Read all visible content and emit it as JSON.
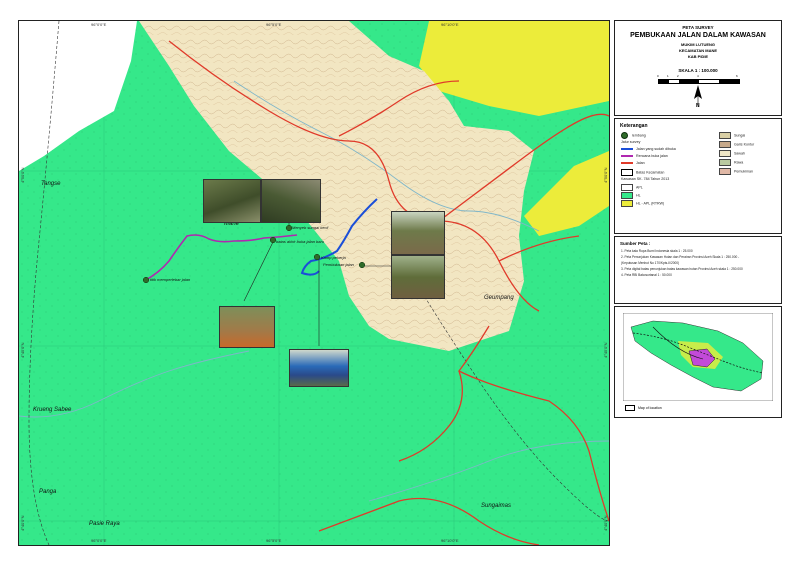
{
  "coords": {
    "top": [
      "96°0'0\"E",
      "96°5'0\"E",
      "96°10'0\"E"
    ],
    "bottom": [
      "96°0'0\"E",
      "96°5'0\"E",
      "96°10'0\"E"
    ],
    "left": [
      "4°50'0\"N",
      "4°45'0\"N",
      "4°40'0\"N"
    ],
    "right": [
      "4°50'0\"N",
      "4°45'0\"N",
      "4°40'0\"N"
    ]
  },
  "places": {
    "tangse": "Tangse",
    "mane": "Mane",
    "geumpang": "Geumpang",
    "krueng_sabee": "Krueng Sabee",
    "panga": "Panga",
    "pasie_raya": "Pasie Raya",
    "sungaimas": "Sungaimas"
  },
  "annotations": {
    "menyeb": "Menyeb sungai kecil",
    "batas": "batas akhir buka jalan baru",
    "pembukaan": "Pembukaan jalan",
    "kamp": "Kamp pekerja",
    "titik": "titik memperlebar jalan"
  },
  "title": {
    "survey": "PETA SURVEY",
    "main": "PEMBUKAAN JALAN DALAM KAWASAN",
    "mukim": "MUKIM LUTUENG",
    "kecamatan": "KECAMATAN MANE",
    "kab": "KAB PIDIE",
    "scale": "SKALA 1 : 100.000",
    "scale_nums": [
      "0",
      "1",
      "2",
      "4",
      "6"
    ],
    "north": "N"
  },
  "legend": {
    "heading": "Keterangan",
    "left": [
      {
        "label": "lembang",
        "kind": "dot"
      },
      {
        "label": "Jalur survey",
        "kind": "head"
      },
      {
        "label": "Jalan yang sudah dibuka",
        "kind": "line",
        "color": "#1b4fd8"
      },
      {
        "label": "Rencana buka jalan",
        "kind": "line",
        "color": "#b028b0"
      },
      {
        "label": "Jalan",
        "kind": "line",
        "color": "#e03a2a"
      },
      {
        "label": "Batas Kecamatan",
        "kind": "box"
      },
      {
        "label": "Kawasan SK. 784 Tahun 2013",
        "kind": "head"
      },
      {
        "label": "APL",
        "kind": "fill",
        "color": "#ffffff"
      },
      {
        "label": "HL",
        "kind": "fill",
        "color": "#35e88a"
      },
      {
        "label": "HL - APL (RTRW)",
        "kind": "fill",
        "color": "#ecec3a"
      }
    ],
    "right": [
      {
        "label": "Sungai",
        "color": "#d9cfa5"
      },
      {
        "label": "Garis Kontur",
        "color": "#c7a98a"
      },
      {
        "label": "Sawah",
        "color": "#efe6c6"
      },
      {
        "label": "Rawa",
        "color": "#b9c9a0"
      },
      {
        "label": "Pemukiman",
        "color": "#e0b8a6"
      }
    ]
  },
  "sources": {
    "heading": "Sumber Peta :",
    "lines": [
      "1. Peta kala Rupa Bumi Indonesia skala 1 : 25.000",
      "2. Peta Penunjukan Kawasan Hutan dan Perairan Provinsi Aceh  Skala 1 : 250.000 -",
      "   (Keputusan Menhut No 170/Kpts-II/2000)",
      "3. Peta digital batas penunjukan batas kawasan hutan Provinsi Aceh  skala 1 : 250.000",
      "4. Peta RBI Bakosurtanal 1 : 50.000"
    ]
  },
  "inset": {
    "caption": "Map of location"
  },
  "colors": {
    "forest": "#35e88a",
    "apl": "#f2e6c2",
    "yellow": "#ecec3a",
    "road": "#e03a2a",
    "opened_road": "#1b4fd8",
    "planned_road": "#b028b0"
  }
}
